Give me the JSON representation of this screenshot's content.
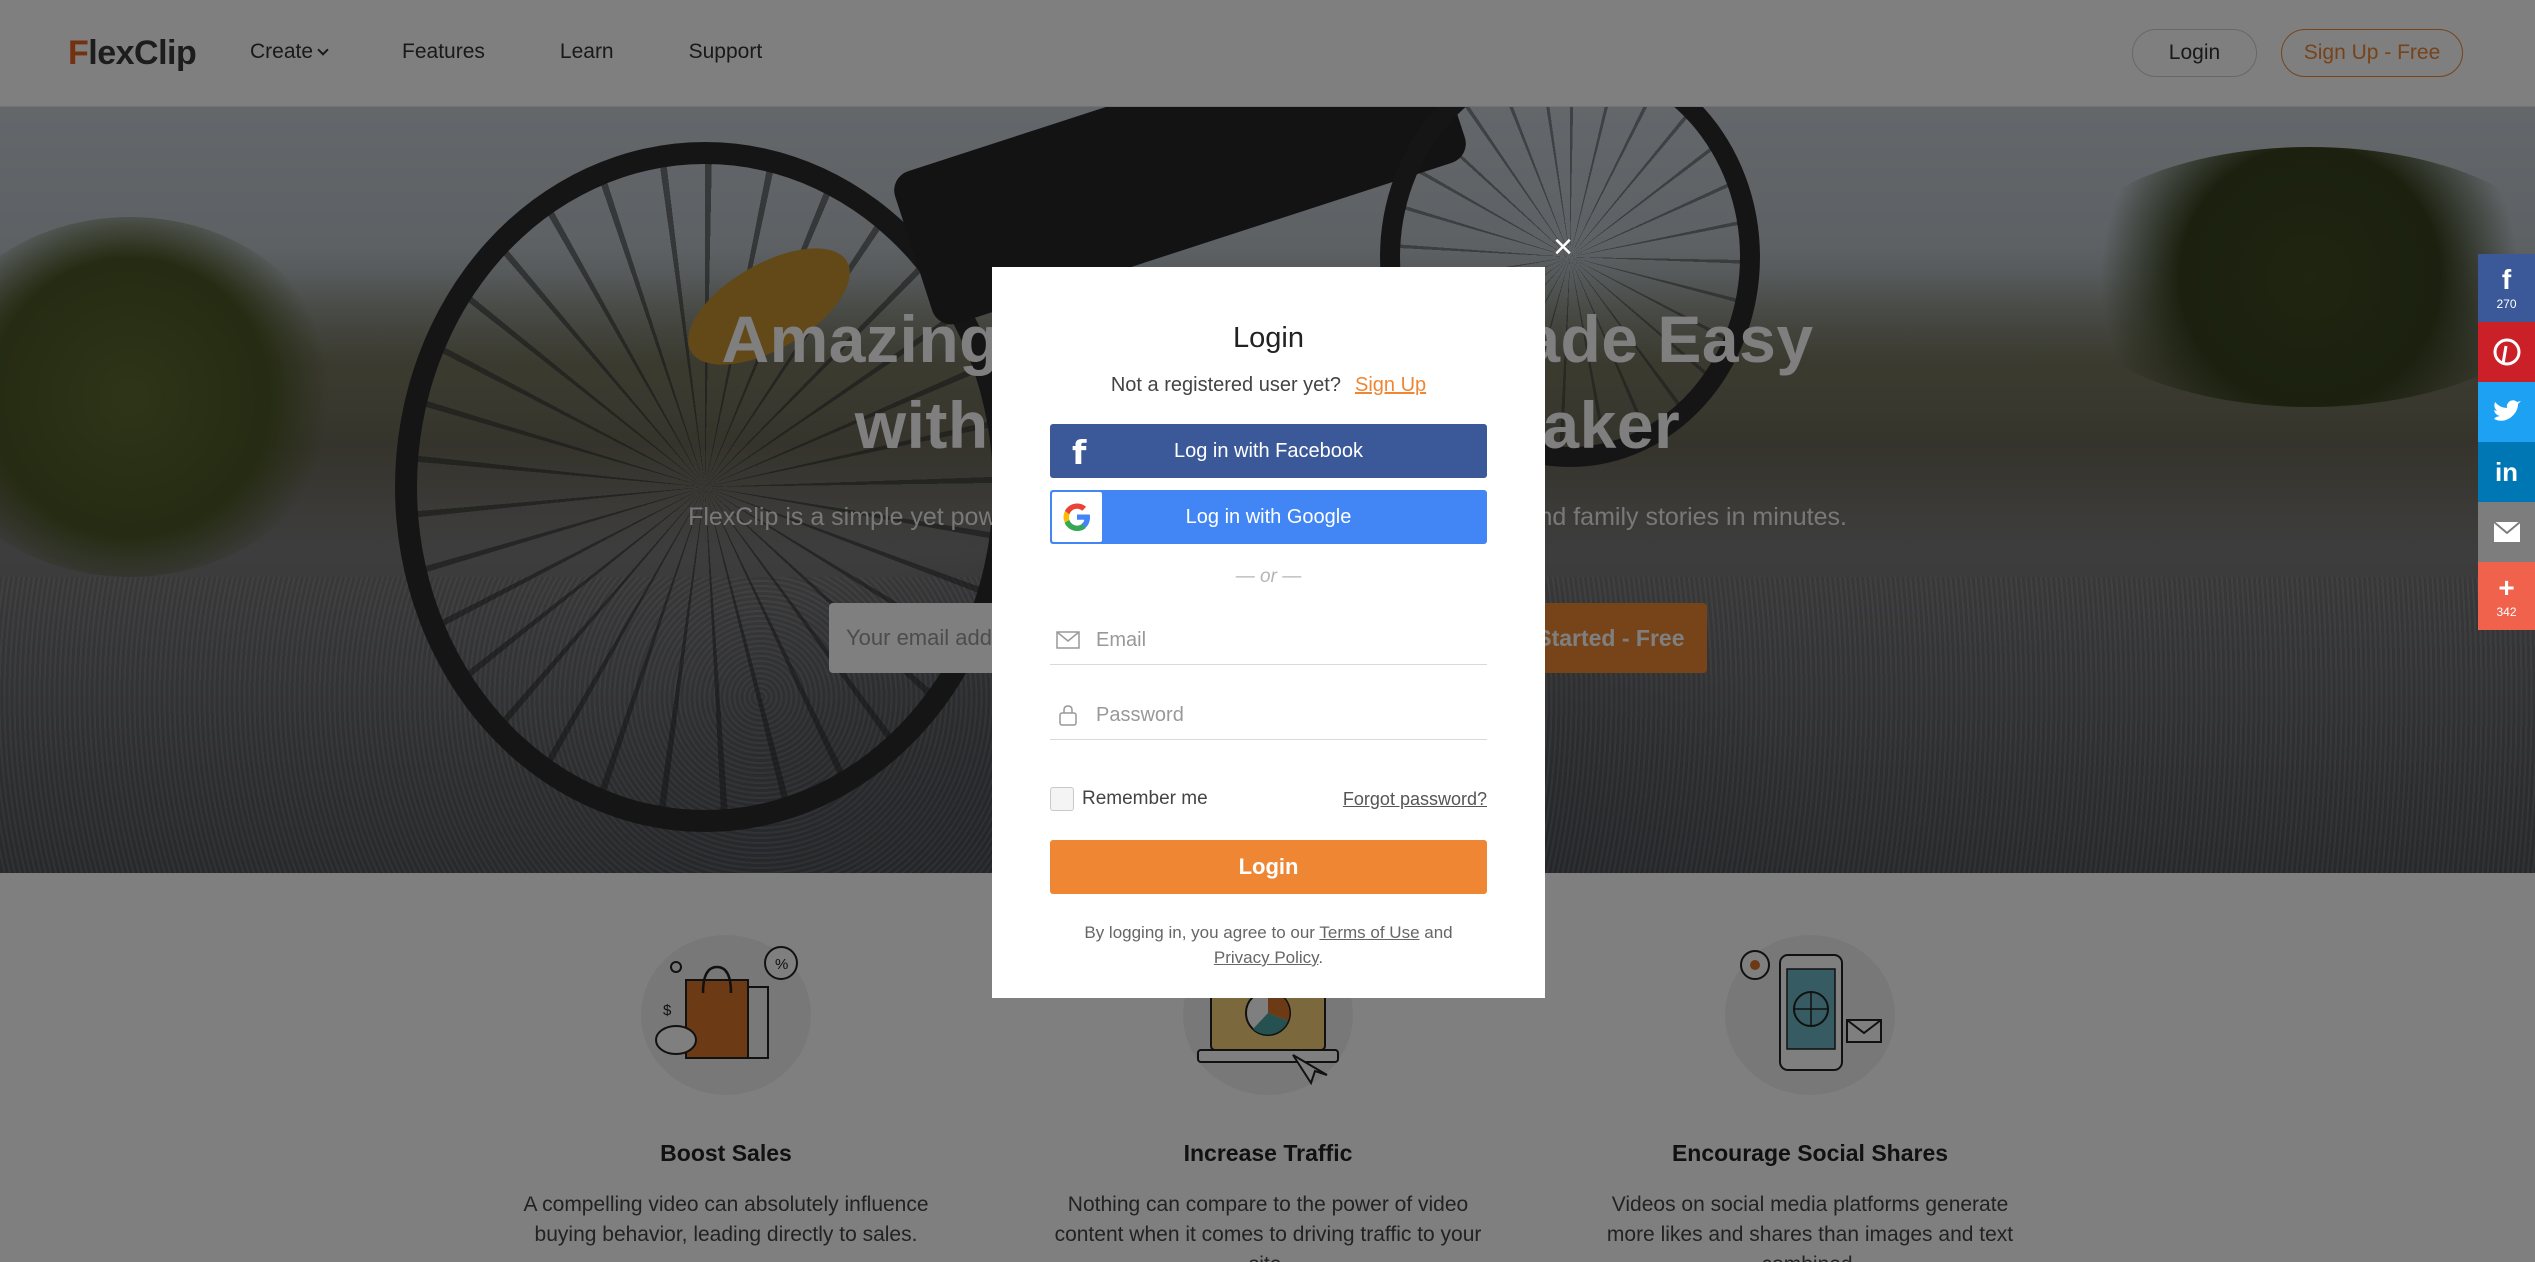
{
  "header": {
    "logo_text": "FlexClip",
    "nav": [
      {
        "label": "Create",
        "has_dropdown": true
      },
      {
        "label": "Features"
      },
      {
        "label": "Learn"
      },
      {
        "label": "Support"
      }
    ],
    "login_label": "Login",
    "signup_label": "Sign Up - Free"
  },
  "hero": {
    "title_line1": "Amazing Video Making Made Easy",
    "title_line2": "with FlexClip Video Maker",
    "subtitle": "FlexClip is a simple yet powerful video maker to help you tell your business and family stories in minutes.",
    "email_placeholder": "Your email address",
    "cta_label": "Get Started - Free"
  },
  "features": [
    {
      "title": "Boost Sales",
      "desc": "A compelling video can absolutely influence buying behavior, leading directly to sales.",
      "icon": "shopping-bag-icon"
    },
    {
      "title": "Increase Traffic",
      "desc": "Nothing can compare to the power of video content when it comes to driving traffic to your site.",
      "icon": "laptop-chart-icon"
    },
    {
      "title": "Encourage Social Shares",
      "desc": "Videos on social media platforms generate more likes and shares than images and text combined.",
      "icon": "phone-globe-icon"
    }
  ],
  "share_bar": {
    "facebook_count": "270",
    "more_count": "342",
    "colors": {
      "facebook": "#3b5998",
      "pinterest": "#cb2027",
      "twitter": "#1da1f2",
      "linkedin": "#0077b5",
      "email": "#7d7d7d",
      "more": "#f0624c"
    }
  },
  "modal": {
    "title": "Login",
    "register_prompt": "Not a registered user yet?",
    "register_link": "Sign Up",
    "facebook_button": "Log in with Facebook",
    "google_button": "Log in with Google",
    "or_text": "or",
    "email_placeholder": "Email",
    "password_placeholder": "Password",
    "remember_label": "Remember me",
    "remember_checked": false,
    "forgot_link": "Forgot password?",
    "login_button": "Login",
    "terms_prefix": "By logging in, you agree to our",
    "terms_link": "Terms of Use",
    "terms_and": "and",
    "privacy_link": "Privacy Policy",
    "close_glyph": "×"
  },
  "colors": {
    "accent": "#ef8633",
    "facebook": "#3b5998",
    "google": "#4286f5"
  }
}
